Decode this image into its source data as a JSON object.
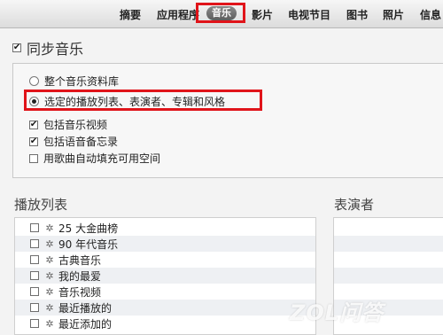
{
  "tabs": [
    {
      "label": "摘要"
    },
    {
      "label": "应用程序"
    },
    {
      "label": "音乐",
      "active": true
    },
    {
      "label": "影片"
    },
    {
      "label": "电视节目"
    },
    {
      "label": "图书"
    },
    {
      "label": "照片"
    },
    {
      "label": "信息"
    }
  ],
  "sync": {
    "checked": true,
    "title": "同步音乐"
  },
  "options": {
    "radio_entire": "整个音乐资料库",
    "radio_selected": "选定的播放列表、表演者、专辑和风格",
    "selected_radio": "radio_selected",
    "include_videos": "包括音乐视频",
    "include_voice_memos": "包括语音备忘录",
    "fill_free_space": "用歌曲自动填充可用空间"
  },
  "playlists": {
    "title": "播放列表",
    "items": [
      {
        "label": "25 大金曲榜",
        "checked": false
      },
      {
        "label": "90 年代音乐",
        "checked": false
      },
      {
        "label": "古典音乐",
        "checked": false
      },
      {
        "label": "我的最爱",
        "checked": false
      },
      {
        "label": "音乐视频",
        "checked": false
      },
      {
        "label": "最近播放的",
        "checked": false
      },
      {
        "label": "最近添加的",
        "checked": false
      }
    ]
  },
  "artists": {
    "title": "表演者"
  },
  "watermark": "ZOL问答",
  "colors": {
    "highlight_border": "#e0141a",
    "active_tab": "#6e6e6e"
  }
}
